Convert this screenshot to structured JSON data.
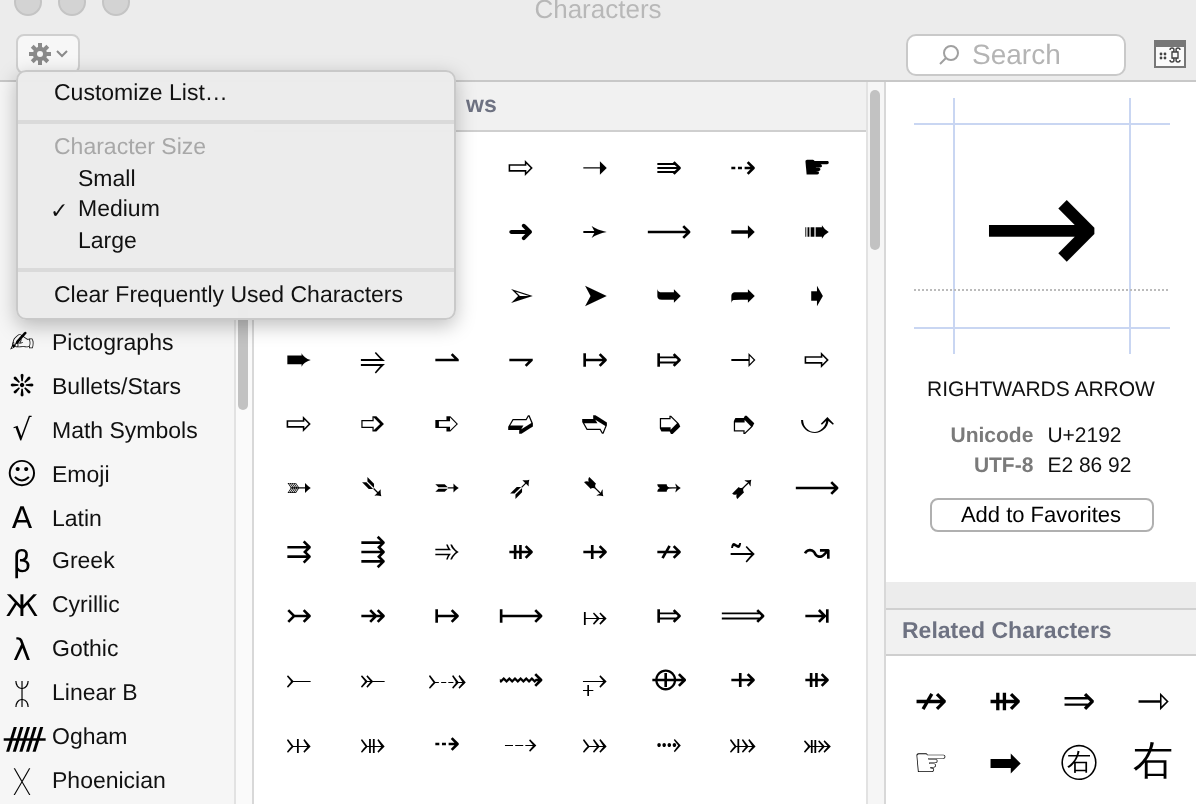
{
  "window": {
    "title": "Characters"
  },
  "toolbar": {
    "search": {
      "placeholder": "Search"
    }
  },
  "menu": {
    "check_mark": "✓",
    "items": [
      {
        "kind": "action",
        "label": "Customize List…"
      },
      {
        "kind": "separator"
      },
      {
        "kind": "header",
        "label": "Character Size"
      },
      {
        "kind": "option",
        "label": "Small",
        "checked": false
      },
      {
        "kind": "option",
        "label": "Medium",
        "checked": true
      },
      {
        "kind": "option",
        "label": "Large",
        "checked": false
      },
      {
        "kind": "separator"
      },
      {
        "kind": "action",
        "label": "Clear Frequently Used Characters"
      }
    ]
  },
  "sidebar": {
    "items": [
      {
        "icon": "✍",
        "label": "Pictographs"
      },
      {
        "icon": "❊",
        "label": "Bullets/Stars"
      },
      {
        "icon": "√",
        "label": "Math Symbols"
      },
      {
        "icon": "☺",
        "label": "Emoji"
      },
      {
        "icon": "A",
        "label": "Latin"
      },
      {
        "icon": "β",
        "label": "Greek"
      },
      {
        "icon": "Ж",
        "label": "Cyrillic"
      },
      {
        "icon": "λ",
        "label": "Gothic"
      },
      {
        "icon": "ᛯ",
        "label": "Linear B"
      },
      {
        "icon": "ᚏ",
        "label": "Ogham"
      },
      {
        "icon": "ᚷ",
        "label": "Phoenician"
      }
    ]
  },
  "grid": {
    "heading": "ws",
    "rows": [
      [
        null,
        null,
        null,
        "⇨",
        "➝",
        "⇛",
        "⇢",
        "☛"
      ],
      [
        null,
        null,
        null,
        "➜",
        "➛",
        "⟶",
        "➞",
        "➠"
      ],
      [
        null,
        null,
        null,
        "➢",
        "➤",
        "➥",
        "➦",
        "➧"
      ],
      [
        "➨",
        "⥤",
        "⇀",
        "⇁",
        "↦",
        "⤇",
        "⇾",
        "⇨"
      ],
      [
        "⇨",
        "➩",
        "➪",
        "➫",
        "➬",
        "➭",
        "➮",
        "⤻"
      ],
      [
        "➳",
        "➴",
        "➵",
        "➶",
        "➷",
        "➸",
        "➹",
        "⟶"
      ],
      [
        "⇉",
        "⇶",
        "➾",
        "⇻",
        "⇸",
        "↛",
        "⥲",
        "↝"
      ],
      [
        "↣",
        "↠",
        "↦",
        "⟼",
        "⤅",
        "⤇",
        "⟹",
        "⇥"
      ],
      [
        "⤚",
        "⤜",
        "⤐",
        "⟿",
        "⥅",
        "⟴",
        "⇸",
        "⇻"
      ],
      [
        "⤔",
        "⤕",
        "⇢",
        "⤏",
        "⤖",
        "⤑",
        "⤗",
        "⤘"
      ]
    ]
  },
  "detail": {
    "glyph": "→",
    "name": "RIGHTWARDS ARROW",
    "fields": [
      {
        "label": "Unicode",
        "value": "U+2192"
      },
      {
        "label": "UTF-8",
        "value": "E2 86 92"
      }
    ],
    "button": "Add to Favorites"
  },
  "related": {
    "heading": "Related Characters",
    "chars": [
      "↛",
      "⇻",
      "⇒",
      "⇾",
      "☞",
      "➡",
      "㊨",
      "右"
    ]
  }
}
